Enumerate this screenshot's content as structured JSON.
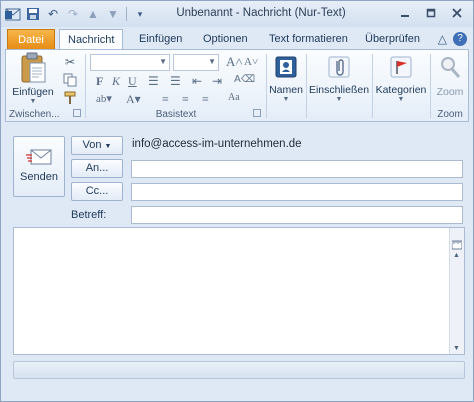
{
  "window": {
    "title": "Unbenannt  -  Nachricht (Nur-Text)",
    "controls": [
      "minimize-icon",
      "restore-icon",
      "close-icon"
    ]
  },
  "quick_access": [
    "outlook-icon",
    "save-icon",
    "undo-icon",
    "redo-icon",
    "up-icon",
    "down-icon",
    "customize-icon"
  ],
  "tabs": [
    {
      "label": "Datei"
    },
    {
      "label": "Nachricht"
    },
    {
      "label": "Einfügen"
    },
    {
      "label": "Optionen"
    },
    {
      "label": "Text formatieren"
    },
    {
      "label": "Überprüfen"
    }
  ],
  "ribbon": {
    "clipboard": {
      "paste_label": "Einfügen",
      "group_label": "Zwischen..."
    },
    "basic_text": {
      "group_label": "Basistext"
    },
    "names": {
      "label": "Namen"
    },
    "include": {
      "label": "Einschließen"
    },
    "categories": {
      "label": "Kategorien"
    },
    "zoom": {
      "button_label": "Zoom",
      "group_label": "Zoom"
    }
  },
  "compose": {
    "send_label": "Senden",
    "from_label": "Von",
    "from_value": "info@access-im-unternehmen.de",
    "to_label": "An...",
    "cc_label": "Cc...",
    "subject_label": "Betreff:",
    "to_value": "",
    "cc_value": "",
    "subject_value": "",
    "body": ""
  },
  "colors": {
    "file_tab": "#e68d16",
    "accent": "#1e395b",
    "background": "#dfe9f5"
  }
}
